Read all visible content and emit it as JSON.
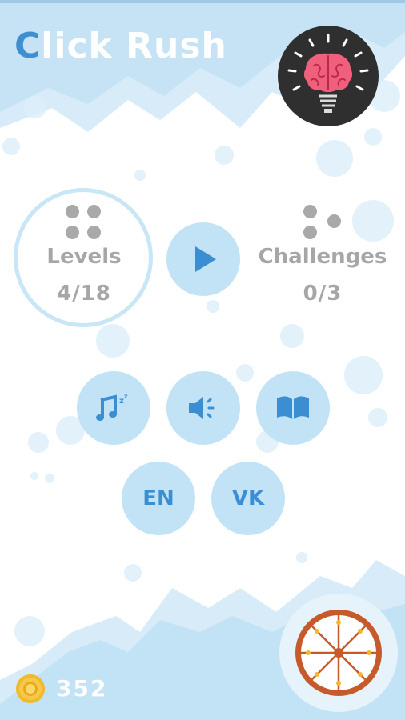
{
  "app": {
    "title_first_letter": "C",
    "title_rest": "lick Rush"
  },
  "modes": {
    "levels": {
      "label": "Levels",
      "progress": "4/18"
    },
    "challenges": {
      "label": "Challenges",
      "progress": "0/3"
    }
  },
  "buttons": {
    "play": "play-icon",
    "music": "music-toggle-icon",
    "sound": "sound-toggle-icon",
    "book": "book-icon",
    "language": "EN",
    "social": "VK"
  },
  "coins": {
    "count": "352"
  },
  "colors": {
    "accent": "#3d8fd1",
    "button_bg": "#c2e3f6",
    "wave_light": "#cfe7f6",
    "wave_mid": "#bcdef3",
    "text_gray": "#a6a6a6",
    "brain_pink": "#f0607d"
  }
}
